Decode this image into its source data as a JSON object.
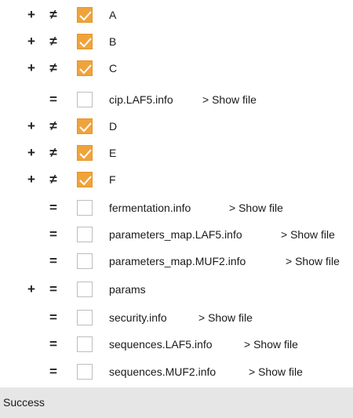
{
  "items": [
    {
      "expand": "+",
      "symbol": "≠",
      "checked": true,
      "label": "A",
      "show_file": ""
    },
    {
      "expand": "+",
      "symbol": "≠",
      "checked": true,
      "label": "B",
      "show_file": ""
    },
    {
      "expand": "+",
      "symbol": "≠",
      "checked": true,
      "label": "C",
      "show_file": ""
    },
    {
      "expand": "",
      "symbol": "=",
      "checked": false,
      "label": "cip.LAF5.info",
      "show_file": "> Show file"
    },
    {
      "expand": "+",
      "symbol": "≠",
      "checked": true,
      "label": "D",
      "show_file": ""
    },
    {
      "expand": "+",
      "symbol": "≠",
      "checked": true,
      "label": "E",
      "show_file": ""
    },
    {
      "expand": "+",
      "symbol": "≠",
      "checked": true,
      "label": "F",
      "show_file": ""
    },
    {
      "expand": "",
      "symbol": "=",
      "checked": false,
      "label": "fermentation.info",
      "show_file": "> Show file"
    },
    {
      "expand": "",
      "symbol": "=",
      "checked": false,
      "label": "parameters_map.LAF5.info",
      "show_file": "> Show file"
    },
    {
      "expand": "",
      "symbol": "=",
      "checked": false,
      "label": "parameters_map.MUF2.info",
      "show_file": "> Show file"
    },
    {
      "expand": "+",
      "symbol": "=",
      "checked": false,
      "label": "params",
      "show_file": ""
    },
    {
      "expand": "",
      "symbol": "=",
      "checked": false,
      "label": "security.info",
      "show_file": "> Show file"
    },
    {
      "expand": "",
      "symbol": "=",
      "checked": false,
      "label": "sequences.LAF5.info",
      "show_file": "> Show file"
    },
    {
      "expand": "",
      "symbol": "=",
      "checked": false,
      "label": "sequences.MUF2.info",
      "show_file": "> Show file"
    }
  ],
  "status": {
    "text": "Success"
  },
  "colors": {
    "checkbox_checked": "#f0a33c",
    "status_bar": "#e6e6e6"
  }
}
